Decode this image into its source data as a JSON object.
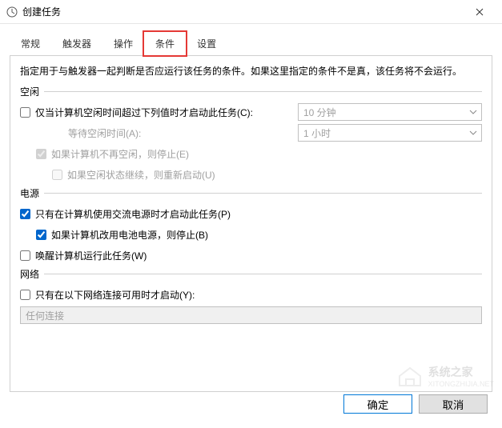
{
  "titlebar": {
    "title": "创建任务"
  },
  "tabs": [
    "常规",
    "触发器",
    "操作",
    "条件",
    "设置"
  ],
  "active_tab_index": 3,
  "panel": {
    "description": "指定用于与触发器一起判断是否应运行该任务的条件。如果这里指定的条件不是真，该任务将不会运行。",
    "idle": {
      "section": "空闲",
      "start_when_idle": {
        "label": "仅当计算机空闲时间超过下列值时才启动此任务(C):",
        "checked": false
      },
      "idle_duration": {
        "value": "10 分钟"
      },
      "wait_label": "等待空闲时间(A):",
      "wait_value": {
        "value": "1 小时"
      },
      "stop_if_not_idle": {
        "label": "如果计算机不再空闲，则停止(E)",
        "checked": true
      },
      "restart_on_idle": {
        "label": "如果空闲状态继续，则重新启动(U)",
        "checked": false
      }
    },
    "power": {
      "section": "电源",
      "ac_only": {
        "label": "只有在计算机使用交流电源时才启动此任务(P)",
        "checked": true
      },
      "stop_on_battery": {
        "label": "如果计算机改用电池电源，则停止(B)",
        "checked": true
      },
      "wake": {
        "label": "唤醒计算机运行此任务(W)",
        "checked": false
      }
    },
    "network": {
      "section": "网络",
      "net_avail": {
        "label": "只有在以下网络连接可用时才启动(Y):",
        "checked": false
      },
      "net_value": "任何连接"
    }
  },
  "buttons": {
    "ok": "确定",
    "cancel": "取消"
  },
  "watermark": {
    "main": "系统之家",
    "sub": "XITONGZHIJIA.NET"
  }
}
